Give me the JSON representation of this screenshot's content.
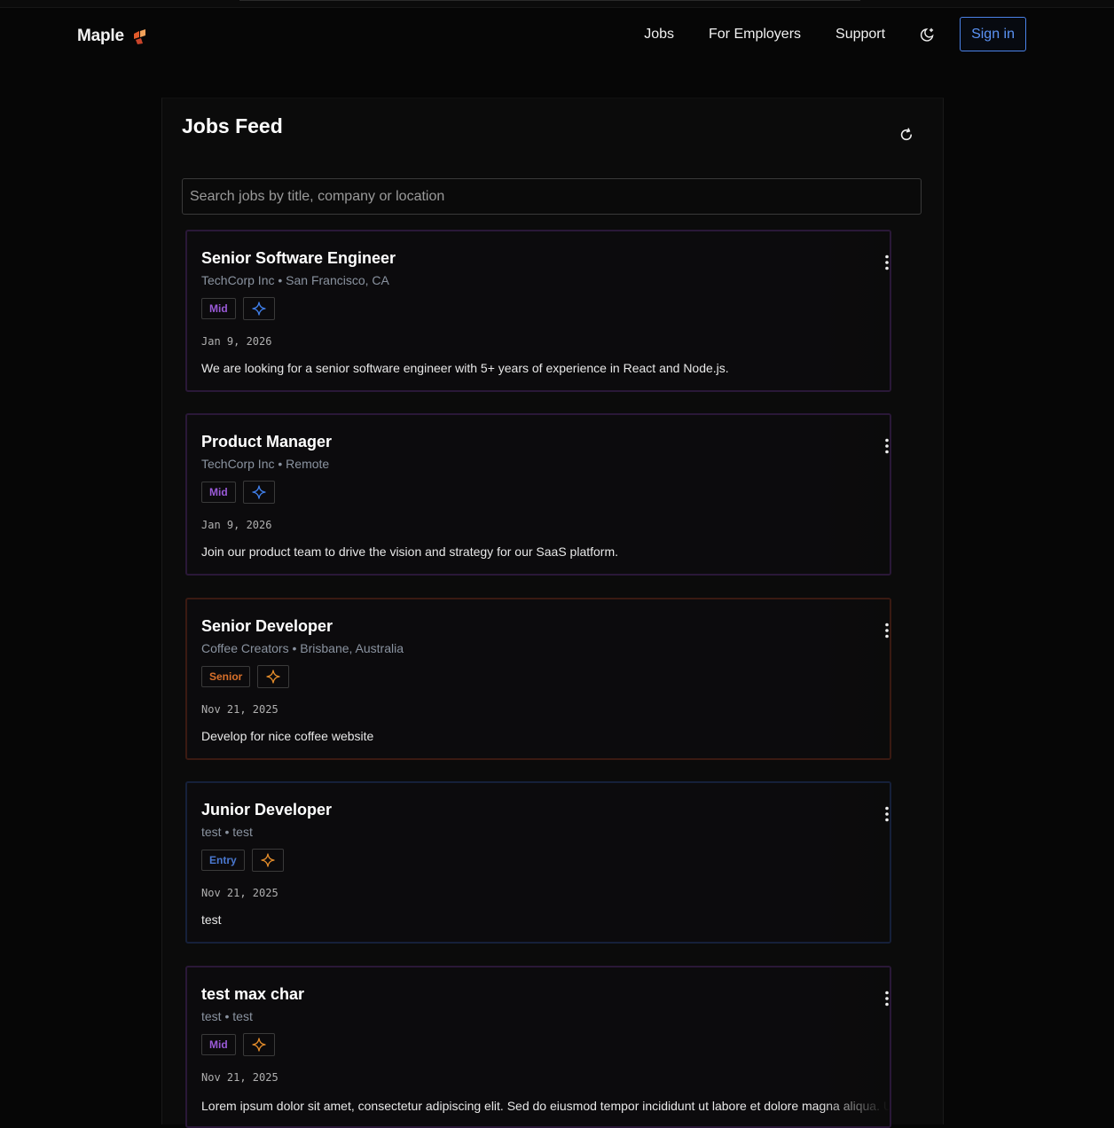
{
  "brand": {
    "name": "Maple"
  },
  "nav": {
    "links": [
      "Jobs",
      "For Employers",
      "Support"
    ],
    "theme_icon": "moon-icon",
    "signin_label": "Sign in"
  },
  "feed": {
    "title": "Jobs Feed",
    "refresh_icon": "refresh-icon",
    "search_placeholder": "Search jobs by title, company or location"
  },
  "jobs": [
    {
      "title": "Senior Software Engineer",
      "company": "TechCorp Inc",
      "location": "San Francisco, CA",
      "level": "Mid",
      "date": "Jan 9, 2026",
      "description": "We are looking for a senior software engineer with 5+ years of experience in React and Node.js."
    },
    {
      "title": "Product Manager",
      "company": "TechCorp Inc",
      "location": "Remote",
      "level": "Mid",
      "date": "Jan 9, 2026",
      "description": "Join our product team to drive the vision and strategy for our SaaS platform."
    },
    {
      "title": "Senior Developer",
      "company": "Coffee Creators",
      "location": "Brisbane, Australia",
      "level": "Senior",
      "date": "Nov 21, 2025",
      "description": "Develop for nice coffee website"
    },
    {
      "title": "Junior Developer",
      "company": "test",
      "location": "test",
      "level": "Entry",
      "date": "Nov 21, 2025",
      "description": "test"
    },
    {
      "title": "test max char",
      "company": "test",
      "location": "test",
      "level": "Mid",
      "date": "Nov 21, 2025",
      "description": "Lorem ipsum dolor sit amet, consectetur adipiscing elit. Sed do eiusmod tempor incididunt ut labore et dolore magna aliqua. Ut"
    }
  ],
  "colors": {
    "mid": "#9a5ad8",
    "senior": "#d9702a",
    "entry": "#4a78d0",
    "sparkle_blue": "#3f7de6",
    "sparkle_orange": "#e08a2a",
    "signin_border": "#4a82e8"
  }
}
